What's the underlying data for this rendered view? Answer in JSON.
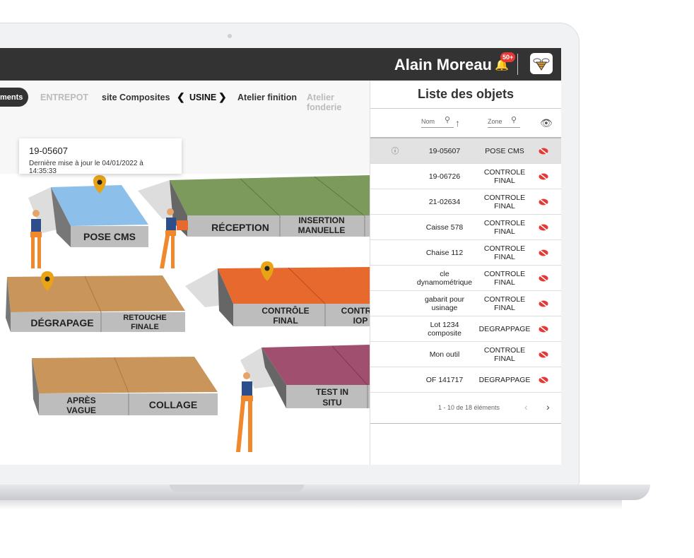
{
  "header": {
    "user": "Alain Moreau",
    "notifications": "50+",
    "logo": "bee-logo"
  },
  "nav": {
    "pill": "ments",
    "items": [
      "ENTREPOT",
      "site Composites",
      "USINE",
      "Atelier finition",
      "Atelier fonderie"
    ],
    "current": "USINE"
  },
  "tooltip": {
    "id": "19-05607",
    "updated": "Dernière mise à jour le 04/01/2022 à 14:35:33"
  },
  "map": {
    "zones": [
      "POSE CMS",
      "RÉCEPTION",
      "INSERTION MANUELLE",
      "DÉGRAPAGE",
      "RETOUCHE FINALE",
      "CONTRÔLE FINAL",
      "CONTR IOP",
      "APRÈS VAGUE",
      "COLLAGE",
      "TEST IN SITU"
    ]
  },
  "panel": {
    "title": "Liste des objets",
    "col_nom": "Nom",
    "col_zone": "Zone",
    "rows": [
      {
        "nom": "19-05607",
        "zone": "POSE CMS",
        "selected": true
      },
      {
        "nom": "19-06726",
        "zone": "CONTROLE FINAL"
      },
      {
        "nom": "21-02634",
        "zone": "CONTROLE FINAL"
      },
      {
        "nom": "Caisse 578",
        "zone": "CONTROLE FINAL"
      },
      {
        "nom": "Chaise 112",
        "zone": "CONTROLE FINAL"
      },
      {
        "nom": "cle dynamométrique",
        "zone": "CONTROLE FINAL"
      },
      {
        "nom": "gabarit pour usinage",
        "zone": "CONTROLE FINAL"
      },
      {
        "nom": "Lot 1234 composite",
        "zone": "DEGRAPPAGE"
      },
      {
        "nom": "Mon outil",
        "zone": "CONTROLE FINAL"
      },
      {
        "nom": "OF 141717",
        "zone": "DEGRAPPAGE"
      }
    ],
    "pagination": "1 - 10 de 18 éléments"
  },
  "colors": {
    "accent": "#e53935",
    "topbar": "#333333",
    "pin": "#e8a317"
  }
}
